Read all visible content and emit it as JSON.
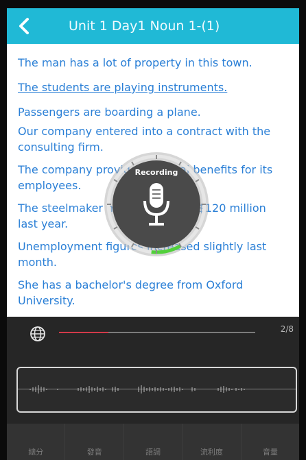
{
  "header": {
    "title": "Unit 1   Day1 Noun 1-(1)",
    "back_icon": "chevron-left-icon",
    "accent_color": "#20b9d6"
  },
  "sentences": [
    {
      "text": "The man has a lot of property in this town.",
      "active": false
    },
    {
      "text": "The students are playing instruments.",
      "active": true
    },
    {
      "text": "Passengers are boarding a plane.",
      "active": false
    },
    {
      "text": "Our company entered into a contract with the consulting firm.",
      "active": false
    },
    {
      "text": "The company provides medical benefits for its employees.",
      "active": false
    },
    {
      "text": "The steelmaker made a profit of $120 million last year.",
      "active": false
    },
    {
      "text": "Unemployment figures increased slightly last month.",
      "active": false
    },
    {
      "text": "She has a bachelor's degree from Oxford University.",
      "active": false
    }
  ],
  "recording": {
    "label": "Recording",
    "progress": 0.1,
    "icon": "microphone-icon"
  },
  "player": {
    "globe_icon": "globe-icon",
    "progress": 0.25,
    "counter": "2/8"
  },
  "scores": [
    {
      "label": "總分"
    },
    {
      "label": "發音"
    },
    {
      "label": "語調"
    },
    {
      "label": "流利度"
    },
    {
      "label": "音量"
    }
  ]
}
